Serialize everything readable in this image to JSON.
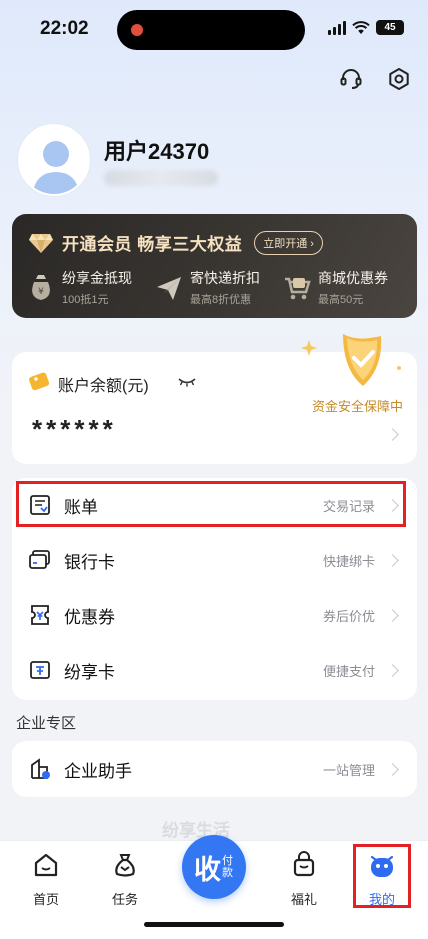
{
  "status_bar": {
    "time": "22:02",
    "battery": "45"
  },
  "profile": {
    "username": "用户24370"
  },
  "vip": {
    "title": "开通会员 畅享三大权益",
    "button": "立即开通",
    "benefits": [
      {
        "title": "纷享金抵现",
        "sub": "100抵1元",
        "icon": "bag-icon"
      },
      {
        "title": "寄快递折扣",
        "sub": "最高8折优惠",
        "icon": "paper-plane-icon"
      },
      {
        "title": "商城优惠券",
        "sub": "最高50元",
        "icon": "cart-icon"
      }
    ]
  },
  "balance": {
    "label": "账户余额(元)",
    "value": "******",
    "safety": "资金安全保障中"
  },
  "menu": [
    {
      "label": "账单",
      "hint": "交易记录",
      "icon": "bill-icon"
    },
    {
      "label": "银行卡",
      "hint": "快捷绑卡",
      "icon": "bank-card-icon"
    },
    {
      "label": "优惠券",
      "hint": "券后价优",
      "icon": "coupon-icon"
    },
    {
      "label": "纷享卡",
      "hint": "便捷支付",
      "icon": "share-card-icon"
    }
  ],
  "enterprise": {
    "section_title": "企业专区",
    "label": "企业助手",
    "hint": "一站管理"
  },
  "watermark": "纷享生活",
  "tabbar": {
    "home": "首页",
    "tasks": "任务",
    "pay_big": "收",
    "pay_small": "付款",
    "gifts": "福礼",
    "mine": "我的"
  },
  "colors": {
    "accent": "#3477f2",
    "highlight": "#e32024",
    "vip_gold": "#f6e2c0"
  }
}
